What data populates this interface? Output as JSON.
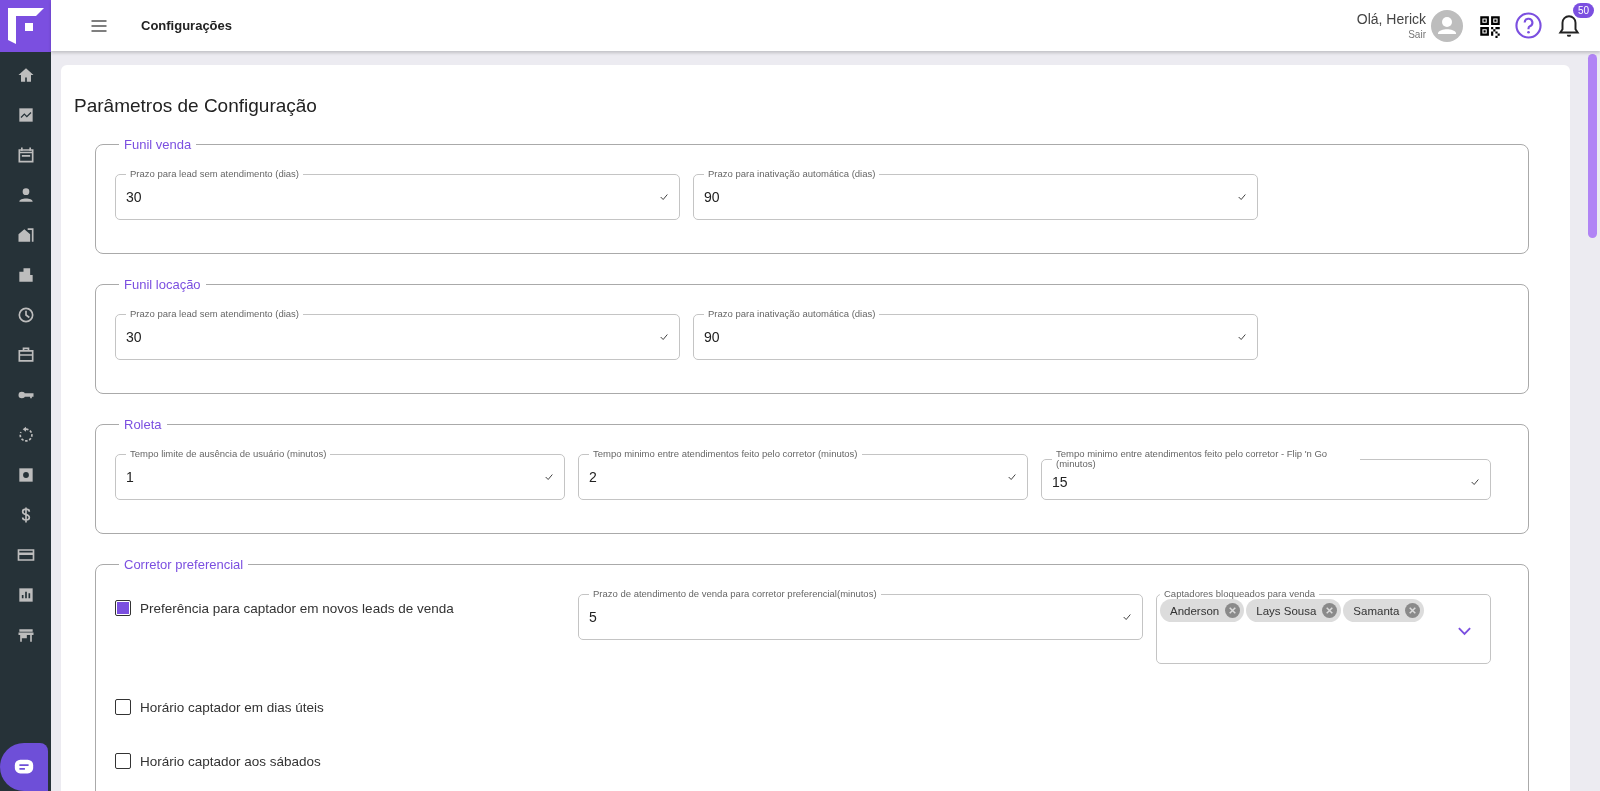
{
  "header": {
    "title": "Configurações",
    "greeting": "Olá, Herick",
    "logout": "Sair",
    "notification_count": "50"
  },
  "page_title": "Parâmetros de Configuração",
  "sections": [
    {
      "title": "Funil venda",
      "rows": [
        [
          {
            "kind": "field",
            "label": "Prazo para lead sem atendimento (dias)",
            "value": "30"
          },
          {
            "kind": "field",
            "label": "Prazo para inativação automática (dias)",
            "value": "90"
          }
        ]
      ]
    },
    {
      "title": "Funil locação",
      "rows": [
        [
          {
            "kind": "field",
            "label": "Prazo para lead sem atendimento (dias)",
            "value": "30"
          },
          {
            "kind": "field",
            "label": "Prazo para inativação automática (dias)",
            "value": "90"
          }
        ]
      ]
    },
    {
      "title": "Roleta",
      "rows": [
        [
          {
            "kind": "field",
            "label": "Tempo limite de ausência de usuário (minutos)",
            "value": "1"
          },
          {
            "kind": "field",
            "label": "Tempo minimo entre atendimentos feito pelo corretor (minutos)",
            "value": "2"
          },
          {
            "kind": "field",
            "label": "Tempo minimo entre atendimentos feito pelo corretor - Flip 'n Go (minutos)",
            "value": "15"
          }
        ]
      ]
    },
    {
      "title": "Corretor preferencial",
      "rows": [
        [
          {
            "kind": "checkbox",
            "label": "Preferência para captador em novos leads de venda",
            "checked": true
          },
          {
            "kind": "field",
            "label": "Prazo de atendimento de venda para corretor preferencial(minutos)",
            "value": "5"
          },
          {
            "kind": "chips",
            "label": "Captadores bloqueados para venda",
            "chips": [
              "Anderson",
              "Lays Sousa",
              "Samanta"
            ]
          }
        ],
        [
          {
            "kind": "checkbox",
            "label": "Horário captador em dias úteis",
            "checked": false
          }
        ],
        [
          {
            "kind": "checkbox",
            "label": "Horário captador aos sábados",
            "checked": false
          }
        ]
      ]
    }
  ]
}
